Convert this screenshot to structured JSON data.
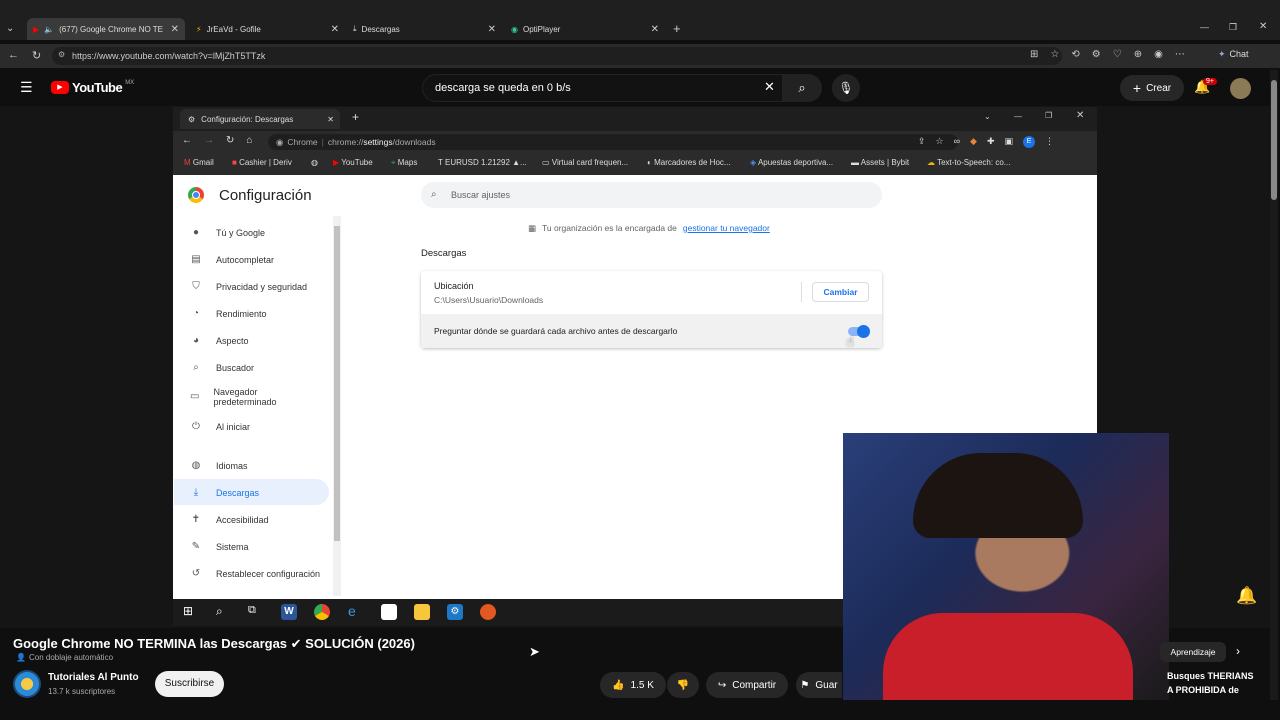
{
  "outer_tabs": [
    {
      "label": "(677) Google Chrome NO TE",
      "active": true
    },
    {
      "label": "JrEaVd - Gofile"
    },
    {
      "label": "Descargas"
    },
    {
      "label": "OptiPlayer"
    }
  ],
  "outer_url": "https://www.youtube.com/watch?v=lMjZhT5TTzk",
  "outer_chat_label": "Chat",
  "yt": {
    "logo_text": "YouTube",
    "region": "MX",
    "search_query": "descarga se queda en 0 b/s",
    "create_label": "Crear",
    "notif_badge": "9+"
  },
  "inner": {
    "tab_title": "Configuración: Descargas",
    "url_chip": "Chrome",
    "url_prefix": "chrome://",
    "url_bold": "settings",
    "url_suffix": "/downloads",
    "profile_initial": "E",
    "bookmarks": [
      "Gmail",
      "Cashier | Deriv",
      "YouTube",
      "Maps",
      "EURUSD 1.21292 ▲...",
      "Virtual card frequen...",
      "Marcadores de Hoc...",
      "Apuestas deportiva...",
      "Assets | Bybit",
      "Text-to-Speech: co..."
    ],
    "settings_title": "Configuración",
    "search_placeholder": "Buscar ajustes",
    "sidebar": [
      "Tú y Google",
      "Autocompletar",
      "Privacidad y seguridad",
      "Rendimiento",
      "Aspecto",
      "Buscador",
      "Navegador predeterminado",
      "Al iniciar",
      "Idiomas",
      "Descargas",
      "Accesibilidad",
      "Sistema",
      "Restablecer configuración"
    ],
    "org_notice_prefix": "Tu organización es la encargada de",
    "org_notice_link": "gestionar tu navegador",
    "section_title": "Descargas",
    "location_label": "Ubicación",
    "location_path": "C:\\Users\\Usuario\\Downloads",
    "change_button": "Cambiar",
    "ask_label": "Preguntar dónde se guardará cada archivo antes de descargarlo",
    "ask_toggle_on": true
  },
  "video": {
    "title": "Google Chrome NO TERMINA las Descargas ✔ SOLUCIÓN (2026)",
    "dub_label": "Con doblaje automático",
    "channel_name": "Tutoriales Al Punto",
    "subscribers": "13.7 k suscriptores",
    "subscribe_label": "Suscribirse",
    "likes": "1.5 K",
    "share_label": "Compartir",
    "save_label": "Guar",
    "chip_label": "Aprendizaje",
    "rec_title_1": "Busques THERIANS",
    "rec_title_2": "A PROHIBIDA de"
  },
  "colors": {
    "accent": "#1a73e8",
    "yt_red": "#ff0000",
    "selected_bg": "#e8f0fe"
  }
}
